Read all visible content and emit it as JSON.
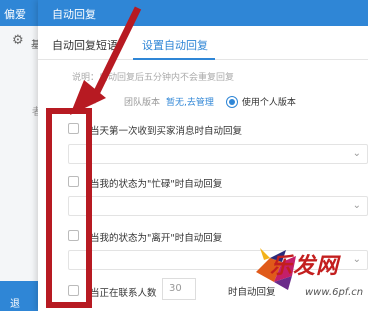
{
  "background": {
    "tab_label": "偏爱",
    "settings_text": "基",
    "side_dot": "者",
    "bottom_text": "退"
  },
  "dialog": {
    "title": "自动回复",
    "tabs": [
      "自动回复短语",
      "设置自动回复"
    ],
    "note": "说明：自动回复后五分钟内不会重复回复",
    "version": {
      "team_label": "团队版本",
      "manage_link": "暂无,去管理",
      "personal_label": "使用个人版本"
    },
    "options": [
      "当天第一次收到买家消息时自动回复",
      "当我的状态为\"忙碌\"时自动回复",
      "当我的状态为\"离开\"时自动回复",
      "当正在联系人数"
    ],
    "contact_count": "30",
    "after_text": "时自动回复"
  },
  "watermark": {
    "brand": "乐发网",
    "url": "www.6pf.cn"
  },
  "colors": {
    "accent": "#2f86d6",
    "annotation": "#b71a22",
    "watermark": "#c31e1e"
  }
}
